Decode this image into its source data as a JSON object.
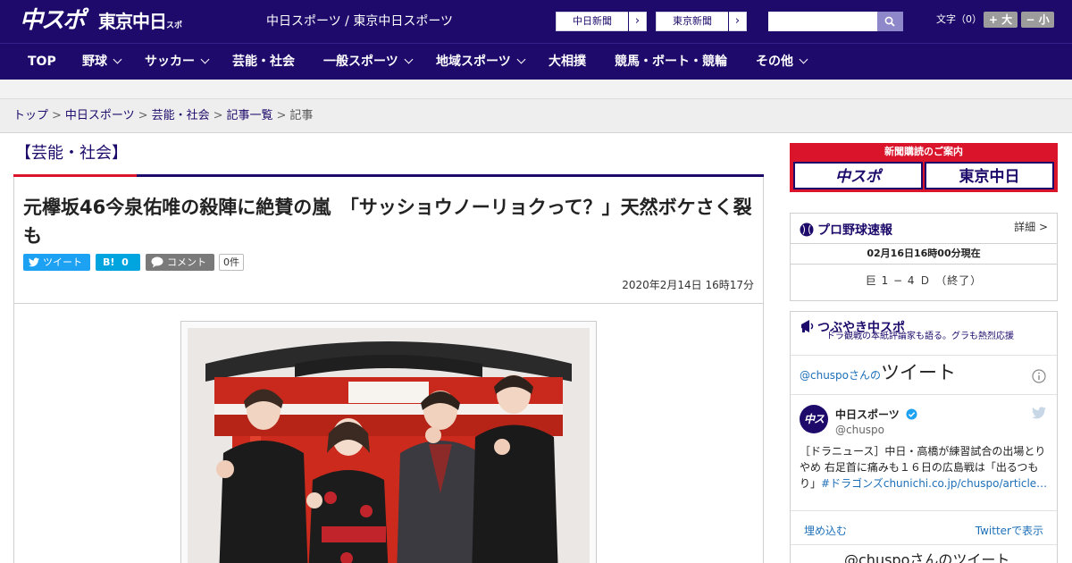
{
  "header": {
    "logo_chuspo": "中スポ",
    "logo_tokyo": "東京中日",
    "logo_tokyo_small": "スポーツ",
    "site_name": "中日スポーツ / 東京中日スポーツ",
    "links": [
      "中日新聞",
      "東京新聞"
    ],
    "search_placeholder": "",
    "font_size_label": "文字（0）",
    "font_larger": "+ 大",
    "font_smaller": "− 小"
  },
  "nav": {
    "items": [
      {
        "label": "TOP",
        "dropdown": false
      },
      {
        "label": "野球",
        "dropdown": true
      },
      {
        "label": "サッカー",
        "dropdown": true
      },
      {
        "label": "芸能・社会",
        "dropdown": false
      },
      {
        "label": "一般スポーツ",
        "dropdown": true
      },
      {
        "label": "地域スポーツ",
        "dropdown": true
      },
      {
        "label": "大相撲",
        "dropdown": false
      },
      {
        "label": "競馬・ボート・競輪",
        "dropdown": false
      },
      {
        "label": "その他",
        "dropdown": true
      }
    ]
  },
  "breadcrumb": {
    "items": [
      "トップ",
      "中日スポーツ",
      "芸能・社会",
      "記事一覧"
    ],
    "current": "記事",
    "separator": ">"
  },
  "article": {
    "section": "【芸能・社会】",
    "headline": "元欅坂46今泉佑唯の殺陣に絶賛の嵐　「サッショウノーリョクって？」天然ボケさく裂も",
    "tweet_label": "ツイート",
    "hatena_label": "B!",
    "hatena_count": "0",
    "comment_label": "コメント",
    "comment_count": "0件",
    "date": "2020年2月14日 16時17分"
  },
  "sidebar": {
    "subscribe_title": "新聞購読のご案内",
    "subscribe_logos": [
      "中スポ",
      "東京中日"
    ],
    "baseball": {
      "title": "プロ野球速報",
      "detail": "詳細 >",
      "timestamp": "02月16日16時00分現在",
      "score": "巨 1 − 4 Ｄ （終了）"
    },
    "tweets": {
      "title": "つぶやき中スポ",
      "subtitle": "ドラ観戦の本紙評論家も語る。グラも熱烈応援",
      "header_account": "@chuspoさんの",
      "header_label": "ツイート",
      "account_name": "中日スポーツ",
      "account_handle": "@chuspo",
      "avatar_text": "中スポ",
      "body": "［ドラニュース］中日・高橋が練習試合の出場とりやめ 右足首に痛みも１６日の広島戦は「出るつもり」",
      "hashtag": "#ドラゴンズ",
      "link": "chunichi.co.jp/chuspo/article…",
      "embed_label": "埋め込む",
      "view_label": "Twitterで表示",
      "next_header": "@chuspoさんのツイート"
    }
  },
  "colors": {
    "brand_navy": "#1d0a6b",
    "accent_red": "#d9142b",
    "twitter_blue": "#1da1f2",
    "hatena_blue": "#00a4de"
  }
}
